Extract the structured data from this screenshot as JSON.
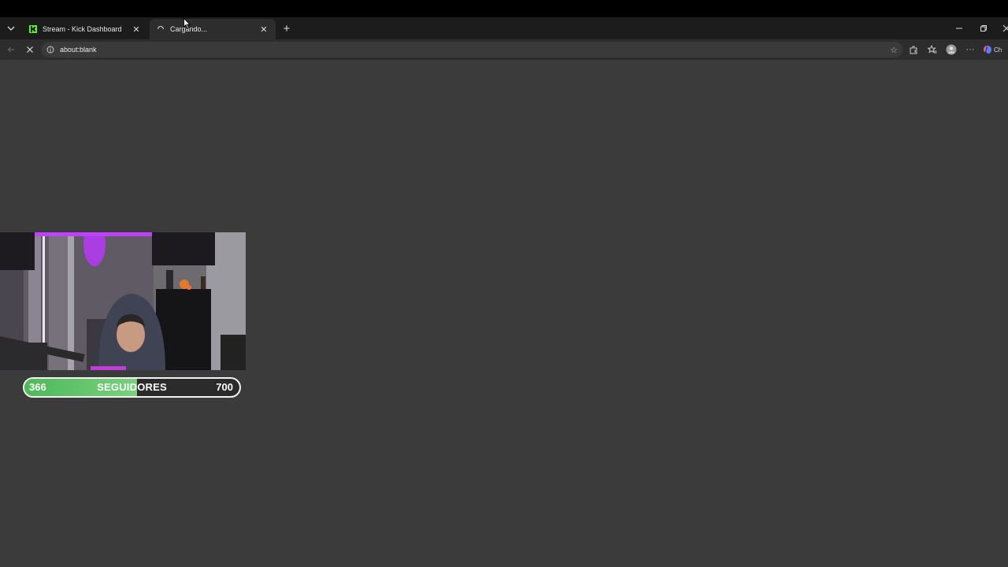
{
  "browser": {
    "tabs": [
      {
        "title": "Stream - Kick Dashboard",
        "favicon": "kick-logo-icon",
        "active": false
      },
      {
        "title": "Cargando...",
        "favicon": "loading-spinner-icon",
        "active": true
      }
    ],
    "address_bar": {
      "url": "about:blank"
    },
    "profile_label": "Ch"
  },
  "overlay": {
    "follower_goal": {
      "current": "366",
      "label": "SEGUIDORES",
      "goal": "700",
      "progress": 0.523
    }
  },
  "colors": {
    "page_background": "#3b3b3b",
    "progress_fill": "#5cbf63",
    "kick_green": "#53fc18"
  }
}
